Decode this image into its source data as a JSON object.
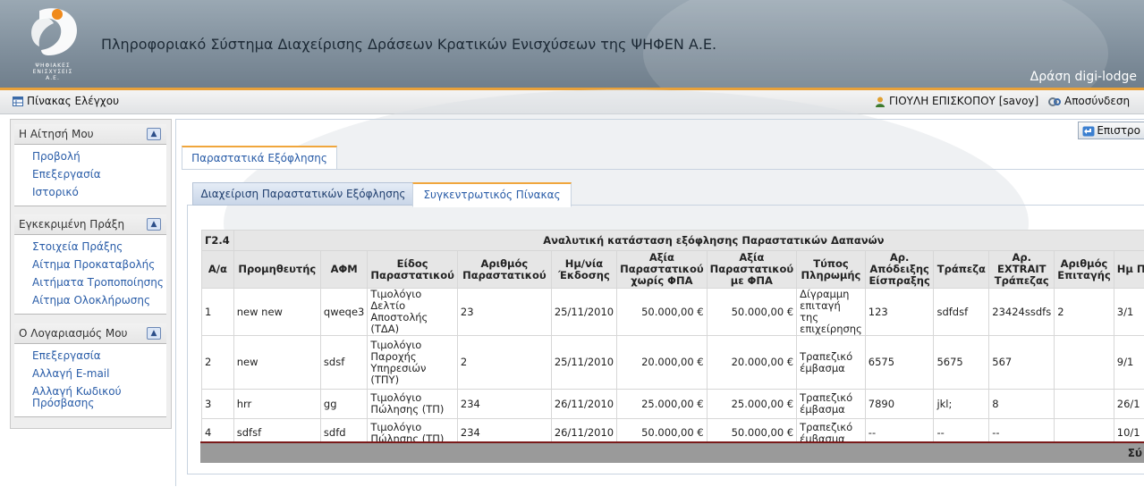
{
  "header": {
    "logo_text": "ΨΗΦΙΑΚΕΣ ΕΝΙΣΧΥΣΕΙΣ",
    "logo_suffix": "Α.Ε.",
    "title": "Πληροφοριακό Σύστημα Διαχείρισης Δράσεων Κρατικών Ενισχύσεων της ΨΗΦΕΝ Α.Ε.",
    "action": "Δράση digi-lodge"
  },
  "toolbar": {
    "dashboard": "Πίνακας Ελέγχου",
    "user": "ΓΙΟΥΛΗ ΕΠΙΣΚΟΠΟΥ [savoy]",
    "logout": "Αποσύνδεση"
  },
  "sidebar": {
    "sections": [
      {
        "title": "Η Αίτησή Μου",
        "links": [
          "Προβολή",
          "Επεξεργασία",
          "Ιστορικό"
        ]
      },
      {
        "title": "Εγκεκριμένη Πράξη",
        "links": [
          "Στοιχεία Πράξης",
          "Αίτημα Προκαταβολής",
          "Αιτήματα Τροποποίησης",
          "Αίτημα Ολοκλήρωσης"
        ]
      },
      {
        "title": "Ο Λογαριασμός Μου",
        "links": [
          "Επεξεργασία",
          "Αλλαγή E-mail",
          "Αλλαγή Κωδικού Πρόσβασης"
        ]
      }
    ]
  },
  "content": {
    "back_button": "Επιστρο",
    "main_tab": "Παραστατικά Εξόφλησης",
    "subtabs": [
      "Διαχείριση Παραστατικών Εξόφλησης",
      "Συγκεντρωτικός Πίνακας"
    ],
    "table": {
      "code": "Γ2.4",
      "caption": "Αναλυτική κατάσταση εξόφλησης Παραστατικών Δαπανών",
      "headers": [
        "Α/α",
        "Προμηθευτής",
        "ΑΦΜ",
        "Είδος Παραστατικού",
        "Αριθμός Παραστατικού",
        "Ημ/νία Έκδοσης",
        "Αξία Παραστατικού χωρίς ΦΠΑ",
        "Αξία Παραστατικού με ΦΠΑ",
        "Τύπος Πληρωμής",
        "Αρ. Απόδειξης Είσπραξης",
        "Τράπεζα",
        "Αρ. EXTRAIT Τράπεζας",
        "Αριθμός Επιταγής",
        "Ημ Πλη"
      ],
      "rows": [
        [
          "1",
          "new new",
          "qweqe3",
          "Τιμολόγιο Δελτίο Αποστολής (ΤΔΑ)",
          "23",
          "25/11/2010",
          "50.000,00 €",
          "50.000,00 €",
          "Δίγραμμη επιταγή της επιχείρησης",
          "123",
          "sdfdsf",
          "23424ssdfs",
          "2",
          "3/1"
        ],
        [
          "2",
          "new",
          "sdsf",
          "Τιμολόγιο Παροχής Υπηρεσιών (ΤΠΥ)",
          "2",
          "25/11/2010",
          "20.000,00 €",
          "20.000,00 €",
          "Τραπεζικό έμβασμα",
          "6575",
          "5675",
          "567",
          "",
          "9/1"
        ],
        [
          "3",
          "hrr",
          "gg",
          "Τιμολόγιο Πώλησης (ΤΠ)",
          "234",
          "26/11/2010",
          "25.000,00 €",
          "25.000,00 €",
          "Τραπεζικό έμβασμα",
          "7890",
          "jkl;",
          "8",
          "",
          "26/1"
        ],
        [
          "4",
          "sdfsf",
          "sdfd",
          "Τιμολόγιο Πώλησης (ΤΠ)",
          "234",
          "26/11/2010",
          "50.000,00 €",
          "50.000,00 €",
          "Τραπεζικό έμβασμα",
          "--",
          "--",
          "--",
          "",
          "10/1"
        ]
      ],
      "footer_label": "Σύ"
    }
  },
  "colors": {
    "accent": "#e8a13a",
    "link": "#2a5da8"
  }
}
